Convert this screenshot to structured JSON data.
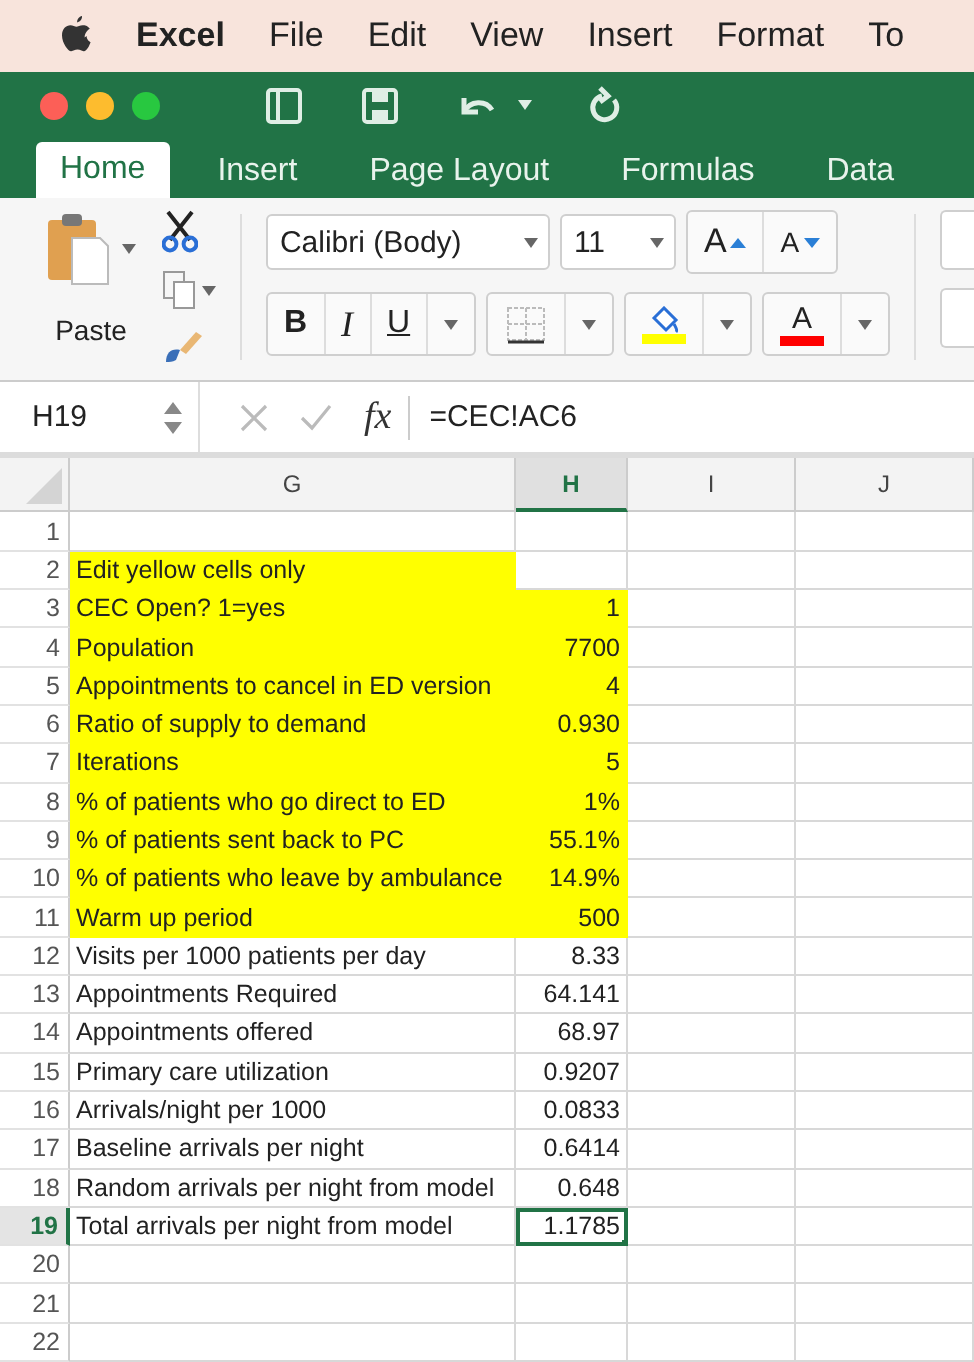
{
  "menu_bar": {
    "app": "Excel",
    "items": [
      "File",
      "Edit",
      "View",
      "Insert",
      "Format",
      "To"
    ]
  },
  "tabs": [
    {
      "label": "Home",
      "selected": true
    },
    {
      "label": "Insert",
      "selected": false
    },
    {
      "label": "Page Layout",
      "selected": false
    },
    {
      "label": "Formulas",
      "selected": false
    },
    {
      "label": "Data",
      "selected": false
    }
  ],
  "ribbon": {
    "paste_label": "Paste",
    "font_name": "Calibri (Body)",
    "font_size": "11",
    "grow_font": "A",
    "shrink_font": "A",
    "bold": "B",
    "italic": "I",
    "underline": "U",
    "font_color_letter": "A"
  },
  "formula_bar": {
    "name_box": "H19",
    "fx": "fx",
    "formula": "=CEC!AC6"
  },
  "columns": [
    {
      "label": "G",
      "selected": false
    },
    {
      "label": "H",
      "selected": true
    },
    {
      "label": "I",
      "selected": false
    },
    {
      "label": "J",
      "selected": false
    }
  ],
  "rows": [
    {
      "number": "1",
      "selected": false
    },
    {
      "number": "2",
      "label": "Edit yellow cells only",
      "label_highlighted": true,
      "value_highlighted": false,
      "selected": false
    },
    {
      "number": "3",
      "label": "CEC Open? 1=yes",
      "value": "1",
      "label_highlighted": true,
      "value_highlighted": true,
      "selected": false
    },
    {
      "number": "4",
      "label": "Population",
      "value": "7700",
      "label_highlighted": true,
      "value_highlighted": true,
      "selected": false
    },
    {
      "number": "5",
      "label": "Appointments to cancel in ED version",
      "value": "4",
      "label_highlighted": true,
      "value_highlighted": true,
      "selected": false
    },
    {
      "number": "6",
      "label": "Ratio of supply to demand",
      "value": "0.930",
      "label_highlighted": true,
      "value_highlighted": true,
      "selected": false
    },
    {
      "number": "7",
      "label": "Iterations",
      "value": "5",
      "label_highlighted": true,
      "value_highlighted": true,
      "selected": false
    },
    {
      "number": "8",
      "label": "% of patients who go direct to ED",
      "value": "1%",
      "label_highlighted": true,
      "value_highlighted": true,
      "selected": false
    },
    {
      "number": "9",
      "label": "% of patients sent back to PC",
      "value": "55.1%",
      "label_highlighted": true,
      "value_highlighted": true,
      "selected": false
    },
    {
      "number": "10",
      "label": "% of patients who leave by ambulance",
      "value": "14.9%",
      "label_highlighted": true,
      "value_highlighted": true,
      "selected": false
    },
    {
      "number": "11",
      "label": "Warm up period",
      "value": "500",
      "label_highlighted": true,
      "value_highlighted": true,
      "selected": false
    },
    {
      "number": "12",
      "label": "Visits per 1000 patients per day",
      "value": "8.33",
      "label_highlighted": false,
      "value_highlighted": false,
      "selected": false
    },
    {
      "number": "13",
      "label": "Appointments Required",
      "value": "64.141",
      "label_highlighted": false,
      "value_highlighted": false,
      "selected": false
    },
    {
      "number": "14",
      "label": "Appointments offered",
      "value": "68.97",
      "label_highlighted": false,
      "value_highlighted": false,
      "selected": false
    },
    {
      "number": "15",
      "label": "Primary care utilization",
      "value": "0.9207",
      "label_highlighted": false,
      "value_highlighted": false,
      "selected": false
    },
    {
      "number": "16",
      "label": "Arrivals/night per 1000",
      "value": "0.0833",
      "label_highlighted": false,
      "value_highlighted": false,
      "selected": false
    },
    {
      "number": "17",
      "label": "Baseline arrivals per night",
      "value": "0.6414",
      "label_highlighted": false,
      "value_highlighted": false,
      "selected": false
    },
    {
      "number": "18",
      "label": "Random arrivals per night from model",
      "value": "0.648",
      "label_highlighted": false,
      "value_highlighted": false,
      "selected": false
    },
    {
      "number": "19",
      "label": "Total arrivals per night from model",
      "value": "1.1785",
      "label_highlighted": false,
      "value_highlighted": false,
      "selected": true
    },
    {
      "number": "20",
      "selected": false
    },
    {
      "number": "21",
      "selected": false
    },
    {
      "number": "22",
      "selected": false
    }
  ]
}
